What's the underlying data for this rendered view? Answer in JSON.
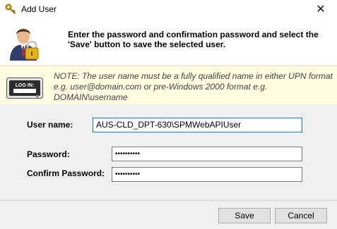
{
  "window": {
    "title": "Add User",
    "close_glyph": "✕"
  },
  "header": {
    "instruction": "Enter the password and confirmation password and select the 'Save' button to save the selected user."
  },
  "note": {
    "text": "NOTE:  The user name must be a fully qualified name in either UPN format e.g. user@domain.com or pre-Windows 2000 format e.g. DOMAIN\\username",
    "login_icon_label": "LOG IN:"
  },
  "form": {
    "username_label": "User name:",
    "username_value": "AUS-CLD_DPT-630\\SPMWebAPIUser",
    "password_label": "Password:",
    "password_value": "••••••••••",
    "confirm_label": "Confirm Password:",
    "confirm_value": "••••••••••"
  },
  "buttons": {
    "save_label": "Save",
    "cancel_label": "Cancel"
  },
  "icons": {
    "title": "key-icon",
    "header": "user-lock-icon",
    "note": "login-icon"
  }
}
